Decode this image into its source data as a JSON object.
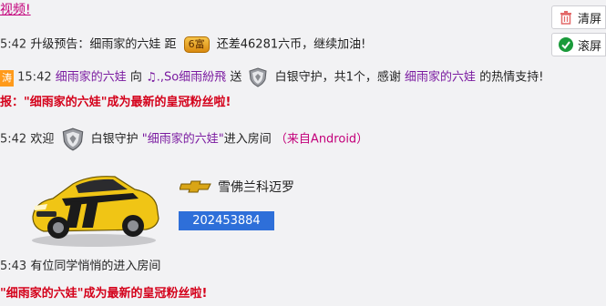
{
  "top_partial": "视频!",
  "buttons": {
    "clear": "清屏",
    "scroll": "滚屏"
  },
  "messages": {
    "m1": {
      "time": "5:42",
      "text_a": "升级预告：细雨家的六娃 距",
      "badge": "6富",
      "text_b": "还差46281六币，继续加油!"
    },
    "m2": {
      "prefix": "涛",
      "time": "15:42",
      "user": "细雨家的六娃",
      "verb": "向",
      "target": "♫.,So细雨紛飛",
      "send": "送",
      "gift": "白银守护，共1个，感谢",
      "user2": "细雨家的六娃",
      "thanks": "的热情支持!"
    },
    "m3": {
      "text": "报：\"细雨家的六娃\"成为最新的皇冠粉丝啦!"
    },
    "m4": {
      "time": "5:42",
      "welcome": "欢迎",
      "role": "白银守护",
      "name": "\"细雨家的六娃\"",
      "enter": "进入房间",
      "source": "（来自Android）"
    },
    "car": {
      "brand": "雪佛兰科迈罗",
      "id": "202453884"
    },
    "m5": {
      "time": "5:43",
      "text": "有位同学悄悄的进入房间"
    },
    "m6": {
      "text": "\"细雨家的六娃\"成为最新的皇冠粉丝啦!"
    }
  },
  "colors": {
    "username": "#7a1aa0",
    "system_red": "#d4001a",
    "source_pink": "#c3007a",
    "id_blue": "#2e6fd9"
  }
}
